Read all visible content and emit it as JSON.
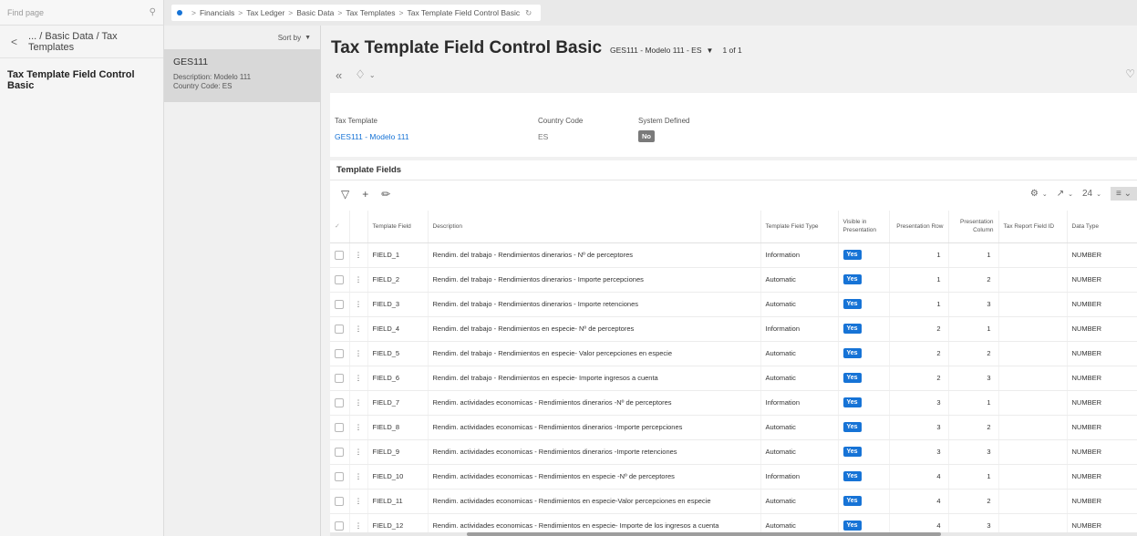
{
  "topbar": {
    "find_placeholder": "Find page",
    "breadcrumb": [
      "Financials",
      "Tax Ledger",
      "Basic Data",
      "Tax Templates",
      "Tax Template Field Control Basic"
    ]
  },
  "leftnav": {
    "back_label": "... / Basic Data / Tax Templates",
    "current_page": "Tax Template Field Control Basic"
  },
  "record_list": {
    "sort_label": "Sort by",
    "records": [
      {
        "title": "GES111",
        "description": "Description:  Modelo 111",
        "country": "Country Code:  ES"
      }
    ]
  },
  "header": {
    "title": "Tax Template Field Control Basic",
    "record_selector": "GES111 - Modelo 111 - ES",
    "record_count": "1 of 1"
  },
  "info": {
    "tax_template_label": "Tax Template",
    "tax_template_value": "GES111 - Modelo 111",
    "country_code_label": "Country Code",
    "country_code_value": "ES",
    "system_defined_label": "System Defined",
    "system_defined_value": "No"
  },
  "template_fields": {
    "section_title": "Template Fields",
    "page_size": "24",
    "columns": {
      "template_field": "Template Field",
      "description": "Description",
      "field_type": "Template Field Type",
      "visible": "Visible in Presentation",
      "row": "Presentation Row",
      "column": "Presentation Column",
      "report_field": "Tax Report Field ID",
      "data_type": "Data Type"
    },
    "rows": [
      {
        "field": "FIELD_1",
        "description": "Rendim. del trabajo - Rendimientos dinerarios - Nº de perceptores",
        "type": "Information",
        "visible": "Yes",
        "row": "1",
        "col": "1",
        "report_id": "",
        "data_type": "NUMBER"
      },
      {
        "field": "FIELD_2",
        "description": "Rendim. del trabajo - Rendimientos dinerarios - Importe percepciones",
        "type": "Automatic",
        "visible": "Yes",
        "row": "1",
        "col": "2",
        "report_id": "",
        "data_type": "NUMBER"
      },
      {
        "field": "FIELD_3",
        "description": "Rendim. del trabajo - Rendimientos dinerarios - Importe retenciones",
        "type": "Automatic",
        "visible": "Yes",
        "row": "1",
        "col": "3",
        "report_id": "",
        "data_type": "NUMBER"
      },
      {
        "field": "FIELD_4",
        "description": "Rendim. del trabajo - Rendimientos en especie- Nº de perceptores",
        "type": "Information",
        "visible": "Yes",
        "row": "2",
        "col": "1",
        "report_id": "",
        "data_type": "NUMBER"
      },
      {
        "field": "FIELD_5",
        "description": "Rendim. del trabajo - Rendimientos en especie- Valor percepciones en especie",
        "type": "Automatic",
        "visible": "Yes",
        "row": "2",
        "col": "2",
        "report_id": "",
        "data_type": "NUMBER"
      },
      {
        "field": "FIELD_6",
        "description": "Rendim. del trabajo - Rendimientos en especie- Importe ingresos a cuenta",
        "type": "Automatic",
        "visible": "Yes",
        "row": "2",
        "col": "3",
        "report_id": "",
        "data_type": "NUMBER"
      },
      {
        "field": "FIELD_7",
        "description": "Rendim. actividades economicas - Rendimientos dinerarios -Nº de perceptores",
        "type": "Information",
        "visible": "Yes",
        "row": "3",
        "col": "1",
        "report_id": "",
        "data_type": "NUMBER"
      },
      {
        "field": "FIELD_8",
        "description": "Rendim. actividades economicas - Rendimientos dinerarios -Importe percepciones",
        "type": "Automatic",
        "visible": "Yes",
        "row": "3",
        "col": "2",
        "report_id": "",
        "data_type": "NUMBER"
      },
      {
        "field": "FIELD_9",
        "description": "Rendim. actividades economicas - Rendimientos dinerarios -Importe retenciones",
        "type": "Automatic",
        "visible": "Yes",
        "row": "3",
        "col": "3",
        "report_id": "",
        "data_type": "NUMBER"
      },
      {
        "field": "FIELD_10",
        "description": "Rendim. actividades economicas - Rendimientos en especie -Nº de perceptores",
        "type": "Information",
        "visible": "Yes",
        "row": "4",
        "col": "1",
        "report_id": "",
        "data_type": "NUMBER"
      },
      {
        "field": "FIELD_11",
        "description": "Rendim. actividades economicas - Rendimientos en especie-Valor percepciones en especie",
        "type": "Automatic",
        "visible": "Yes",
        "row": "4",
        "col": "2",
        "report_id": "",
        "data_type": "NUMBER"
      },
      {
        "field": "FIELD_12",
        "description": "Rendim. actividades economicas - Rendimientos en especie- Importe de los ingresos a cuenta",
        "type": "Automatic",
        "visible": "Yes",
        "row": "4",
        "col": "3",
        "report_id": "",
        "data_type": "NUMBER"
      }
    ]
  },
  "colors": {
    "accent": "#1673d6",
    "badge_no": "#7a7a7a",
    "selected_record": "#d8d8d8"
  },
  "icons": [
    "search-icon",
    "chevron-left-icon",
    "collapse-icon",
    "bell-icon",
    "heart-icon",
    "filter-icon",
    "add-icon",
    "edit-icon",
    "settings-icon",
    "export-icon",
    "menu-icon",
    "refresh-icon"
  ]
}
